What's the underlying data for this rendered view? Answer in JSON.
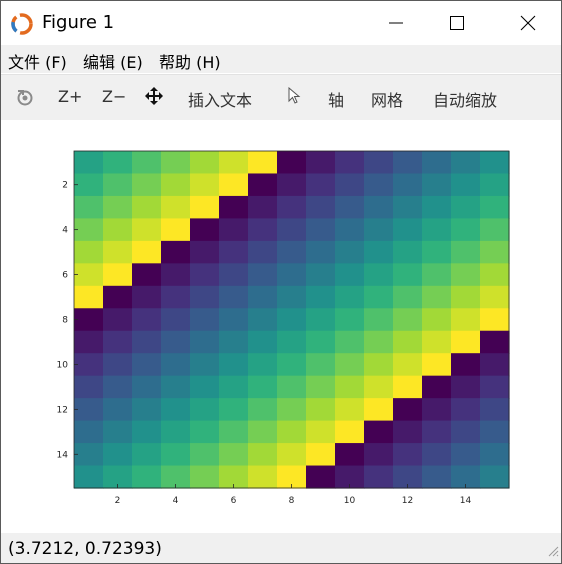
{
  "window": {
    "title": "Figure 1"
  },
  "icons": {
    "app": "matlab-figure-icon",
    "minimize": "minimize-icon",
    "maximize": "maximize-icon",
    "close": "close-icon",
    "rotate": "rotate-3d-icon",
    "pan": "pan-move-icon",
    "cursor": "data-cursor-icon",
    "resize": "resize-grip-icon"
  },
  "menu": [
    {
      "label": "文件 (F)"
    },
    {
      "label": "编辑 (E)"
    },
    {
      "label": "帮助 (H)"
    }
  ],
  "toolbar": {
    "zoom_in": "Z+",
    "zoom_out": "Z−",
    "insert_text": "插入文本",
    "axes": "轴",
    "grid": "网格",
    "auto_scale": "自动缩放"
  },
  "status": {
    "coords": "(3.7212, 0.72393)"
  },
  "chart_data": {
    "type": "heatmap",
    "colormap": "viridis",
    "rows": 15,
    "cols": 15,
    "x_ticks": [
      "2",
      "4",
      "6",
      "8",
      "10",
      "12",
      "14"
    ],
    "y_ticks": [
      "2",
      "4",
      "6",
      "8",
      "10",
      "12",
      "14"
    ],
    "xlim": [
      0.5,
      15.5
    ],
    "ylim": [
      0.5,
      15.5
    ],
    "y_direction": "reverse",
    "values": [
      [
        8,
        9,
        10,
        11,
        12,
        13,
        14,
        0,
        1,
        2,
        3,
        4,
        5,
        6,
        7
      ],
      [
        9,
        10,
        11,
        12,
        13,
        14,
        0,
        1,
        2,
        3,
        4,
        5,
        6,
        7,
        8
      ],
      [
        10,
        11,
        12,
        13,
        14,
        0,
        1,
        2,
        3,
        4,
        5,
        6,
        7,
        8,
        9
      ],
      [
        11,
        12,
        13,
        14,
        0,
        1,
        2,
        3,
        4,
        5,
        6,
        7,
        8,
        9,
        10
      ],
      [
        12,
        13,
        14,
        0,
        1,
        2,
        3,
        4,
        5,
        6,
        7,
        8,
        9,
        10,
        11
      ],
      [
        13,
        14,
        0,
        1,
        2,
        3,
        4,
        5,
        6,
        7,
        8,
        9,
        10,
        11,
        12
      ],
      [
        14,
        0,
        1,
        2,
        3,
        4,
        5,
        6,
        7,
        8,
        9,
        10,
        11,
        12,
        13
      ],
      [
        0,
        1,
        2,
        3,
        4,
        5,
        6,
        7,
        8,
        9,
        10,
        11,
        12,
        13,
        14
      ],
      [
        1,
        2,
        3,
        4,
        5,
        6,
        7,
        8,
        9,
        10,
        11,
        12,
        13,
        14,
        0
      ],
      [
        2,
        3,
        4,
        5,
        6,
        7,
        8,
        9,
        10,
        11,
        12,
        13,
        14,
        0,
        1
      ],
      [
        3,
        4,
        5,
        6,
        7,
        8,
        9,
        10,
        11,
        12,
        13,
        14,
        0,
        1,
        2
      ],
      [
        4,
        5,
        6,
        7,
        8,
        9,
        10,
        11,
        12,
        13,
        14,
        0,
        1,
        2,
        3
      ],
      [
        5,
        6,
        7,
        8,
        9,
        10,
        11,
        12,
        13,
        14,
        0,
        1,
        2,
        3,
        4
      ],
      [
        6,
        7,
        8,
        9,
        10,
        11,
        12,
        13,
        14,
        0,
        1,
        2,
        3,
        4,
        5
      ],
      [
        7,
        8,
        9,
        10,
        11,
        12,
        13,
        14,
        0,
        1,
        2,
        3,
        4,
        5,
        6
      ]
    ],
    "vmin": 0,
    "vmax": 14
  }
}
